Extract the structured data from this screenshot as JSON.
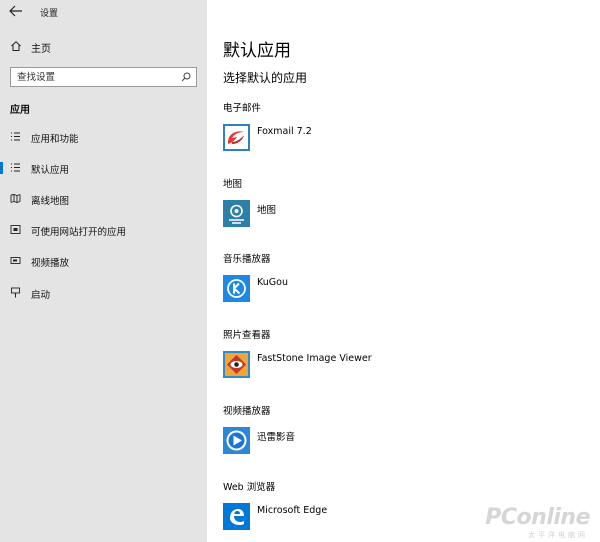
{
  "window": {
    "title": "设置"
  },
  "sidebar": {
    "home_label": "主页",
    "search_placeholder": "查找设置",
    "section_header": "应用",
    "items": [
      {
        "label": "应用和功能",
        "icon": "list-icon",
        "active": false
      },
      {
        "label": "默认应用",
        "icon": "default-apps-icon",
        "active": true
      },
      {
        "label": "离线地图",
        "icon": "offline-map-icon",
        "active": false
      },
      {
        "label": "可使用网站打开的应用",
        "icon": "website-open-icon",
        "active": false
      },
      {
        "label": "视频播放",
        "icon": "video-icon",
        "active": false
      },
      {
        "label": "启动",
        "icon": "startup-icon",
        "active": false
      }
    ]
  },
  "main": {
    "title": "默认应用",
    "subtitle": "选择默认的应用",
    "categories": [
      {
        "label": "电子邮件",
        "app": "Foxmail 7.2",
        "icon": "foxmail-icon",
        "color": "#e53935"
      },
      {
        "label": "地图",
        "app": "地图",
        "icon": "maps-icon",
        "color": "#1f6f9a"
      },
      {
        "label": "音乐播放器",
        "app": "KuGou",
        "icon": "kugou-icon",
        "color": "#1e88e5"
      },
      {
        "label": "照片查看器",
        "app": "FastStone Image Viewer",
        "icon": "faststone-icon",
        "color": "#f39c12"
      },
      {
        "label": "视频播放器",
        "app": "迅雷影音",
        "icon": "xunlei-icon",
        "color": "#1976d2"
      },
      {
        "label": "Web 浏览器",
        "app": "Microsoft Edge",
        "icon": "edge-icon",
        "color": "#0078d7"
      }
    ]
  },
  "watermark": {
    "brand": "PConline",
    "sub": "太平洋电脑网"
  },
  "colors": {
    "accent": "#0078d7",
    "sidebar_bg": "#e4e4e4"
  }
}
